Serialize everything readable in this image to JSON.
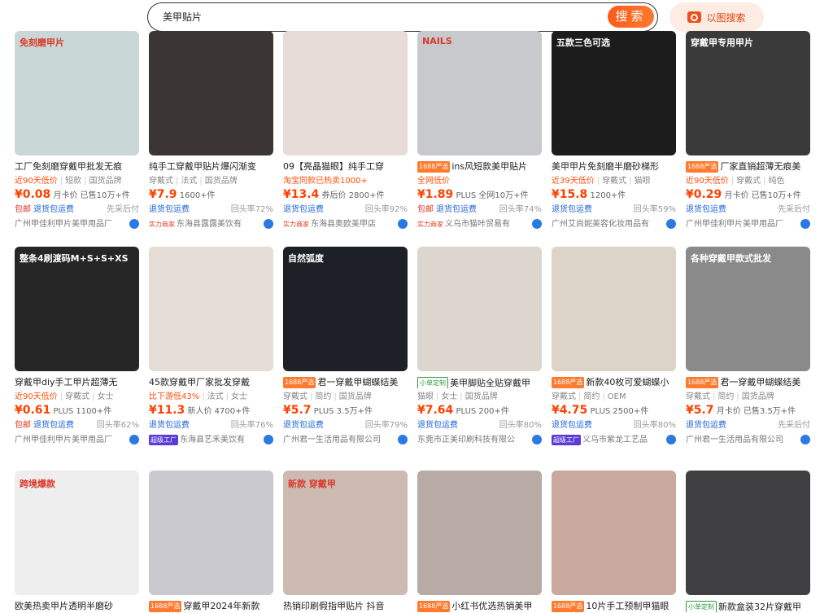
{
  "search": {
    "query": "美甲贴片",
    "button": "搜索",
    "image_search": "以图搜索"
  },
  "products": [
    {
      "thumb": "#c9d8d6",
      "overlay": "免刻磨甲片",
      "title": "工厂免刻磨穿戴甲批发无痕",
      "tag": "",
      "attrs": "近90天低价 | 短款 | 国货品牌",
      "price": "¥0.08",
      "price_suffix": "月卡价 已售10万+件",
      "svc_left": "包邮",
      "svc_mid": "退货包运费",
      "svc_right": "先采后付",
      "shop": "广州甲佳利甲片美甲用品厂"
    },
    {
      "thumb": "#3b3534",
      "overlay": "",
      "title": "纯手工穿戴甲贴片爆闪渐变",
      "tag": "",
      "attrs": "穿戴式 | 法式 | 国货品牌",
      "price": "¥7.9",
      "price_suffix": "1600+件",
      "svc_left": "",
      "svc_mid": "退货包运费",
      "svc_right": "回头率72%",
      "shop": "实力商家 东海县露露美饮有"
    },
    {
      "thumb": "#e8dcd8",
      "overlay": "",
      "title": "09【亮晶猫眼】纯手工穿",
      "tag": "",
      "attrs": "淘宝同款已热卖1000+",
      "price": "¥13.4",
      "price_suffix": "券后价 2800+件",
      "svc_left": "",
      "svc_mid": "退货包运费",
      "svc_right": "回头率92%",
      "shop": "实力商家 东海县奥欧美甲店"
    },
    {
      "thumb": "#c7c9cc",
      "overlay": "NAILS",
      "title": "ins风短款美甲贴片",
      "tag": "1688严选",
      "attrs": "全网低价",
      "price": "¥1.89",
      "price_suffix": "PLUS 全网10万+件",
      "svc_left": "包邮",
      "svc_mid": "退货包运费",
      "svc_right": "回头率74%",
      "shop": "实力商家 义乌市猫咔贸易有"
    },
    {
      "thumb": "#1c1c1c",
      "overlay": "五款三色可选",
      "title": "美甲甲片免刻磨半磨砂梯形",
      "tag": "",
      "attrs": "近39天低价 | 穿戴式 | 猫眼",
      "price": "¥15.8",
      "price_suffix": "1200+件",
      "svc_left": "",
      "svc_mid": "退货包运费",
      "svc_right": "回头率59%",
      "shop": "广州艾尚妮美容化妆用品有"
    },
    {
      "thumb": "#3a3a3a",
      "overlay": "穿戴甲专用甲片",
      "title": "厂家直销超薄无痕美",
      "tag": "1688严选",
      "attrs": "近90天低价 | 穿戴式 | 纯色",
      "price": "¥0.29",
      "price_suffix": "月卡价 已售10万+件",
      "svc_left": "",
      "svc_mid": "退货包运费",
      "svc_right": "先采后付",
      "shop": "广州甲佳利甲片美甲用品厂"
    },
    {
      "thumb": "#262626",
      "overlay": "整条4刷渡码M+S+S+XS",
      "title": "穿戴甲diy手工甲片超薄无",
      "tag": "",
      "attrs": "近90天低价 | 穿戴式 | 女士",
      "price": "¥0.61",
      "price_suffix": "PLUS 1100+件",
      "svc_left": "包邮",
      "svc_mid": "退货包运费",
      "svc_right": "回头率62%",
      "shop": "广州甲佳利甲片美甲用品厂"
    },
    {
      "thumb": "#e6dcd6",
      "overlay": "",
      "title": "45款穿戴甲厂家批发穿戴",
      "tag": "",
      "attrs": "比下游低43% | 法式 | 女士",
      "price": "¥11.3",
      "price_suffix": "新人价 4700+件",
      "svc_left": "",
      "svc_mid": "退货包运费",
      "svc_right": "回头率76%",
      "shop": "超级工厂 东海县艺禾美饮有"
    },
    {
      "thumb": "#1d2127",
      "overlay": "自然弧度",
      "title": "君一穿戴甲蝴蝶结美",
      "tag": "1688严选",
      "attrs": "穿戴式 | 简约 | 国货品牌",
      "price": "¥5.7",
      "price_suffix": "PLUS 3.5万+件",
      "svc_left": "",
      "svc_mid": "退货包运费",
      "svc_right": "回头率79%",
      "shop": "广州君一生活用品有限公司"
    },
    {
      "thumb": "#ddd6cf",
      "overlay": "",
      "title": "美甲脚贴全贴穿戴甲",
      "tag": "小单定制",
      "attrs": "猫眼 | 女士 | 国货品牌",
      "price": "¥7.64",
      "price_suffix": "PLUS 200+件",
      "svc_left": "",
      "svc_mid": "退货包运费",
      "svc_right": "回头率80%",
      "shop": "东莞市正美印刷科技有限公"
    },
    {
      "thumb": "#dcd4c6",
      "overlay": "",
      "title": "新款40枚可爱蝴蝶小",
      "tag": "1688严选",
      "attrs": "穿戴式 | 简约 | OEM",
      "price": "¥4.75",
      "price_suffix": "PLUS 2500+件",
      "svc_left": "",
      "svc_mid": "退货包运费",
      "svc_right": "回头率80%",
      "shop": "超级工厂 义乌市紫龙工艺品"
    },
    {
      "thumb": "#8a8a8a",
      "overlay": "各种穿戴甲款式批发",
      "title": "君一穿戴甲蝴蝶结美",
      "tag": "1688严选",
      "attrs": "穿戴式 | 简约 | 国货品牌",
      "price": "¥5.7",
      "price_suffix": "月卡价 已售3.5万+件",
      "svc_left": "",
      "svc_mid": "退货包运费",
      "svc_right": "先采后付",
      "shop": "广州君一生活用品有限公司"
    },
    {
      "thumb": "#eeeeee",
      "overlay": "跨境爆款",
      "title": "欧美热卖甲片透明半磨砂",
      "tag": "",
      "attrs": "",
      "price": "",
      "price_suffix": "",
      "svc_left": "",
      "svc_mid": "",
      "svc_right": "",
      "shop": ""
    },
    {
      "thumb": "#c9c9cf",
      "overlay": "",
      "title": "穿戴甲2024年新款",
      "tag": "1688严选",
      "attrs": "",
      "price": "",
      "price_suffix": "",
      "svc_left": "",
      "svc_mid": "",
      "svc_right": "",
      "shop": ""
    },
    {
      "thumb": "#cdbab1",
      "overlay": "新款 穿戴甲",
      "title": "热销印刷假指甲贴片 抖音",
      "tag": "",
      "attrs": "",
      "price": "",
      "price_suffix": "",
      "svc_left": "",
      "svc_mid": "",
      "svc_right": "",
      "shop": ""
    },
    {
      "thumb": "#b8aaa4",
      "overlay": "",
      "title": "小红书优选热销美甲",
      "tag": "1688严选",
      "attrs": "",
      "price": "",
      "price_suffix": "",
      "svc_left": "",
      "svc_mid": "",
      "svc_right": "",
      "shop": ""
    },
    {
      "thumb": "#c9a89e",
      "overlay": "",
      "title": "10片手工预制甲猫眼",
      "tag": "1688严选",
      "attrs": "",
      "price": "",
      "price_suffix": "",
      "svc_left": "",
      "svc_mid": "",
      "svc_right": "",
      "shop": ""
    },
    {
      "thumb": "#3f3f42",
      "overlay": "",
      "title": "新款盒装32片穿戴甲",
      "tag": "小单定制",
      "attrs": "",
      "price": "",
      "price_suffix": "",
      "svc_left": "",
      "svc_mid": "",
      "svc_right": "",
      "shop": ""
    }
  ]
}
